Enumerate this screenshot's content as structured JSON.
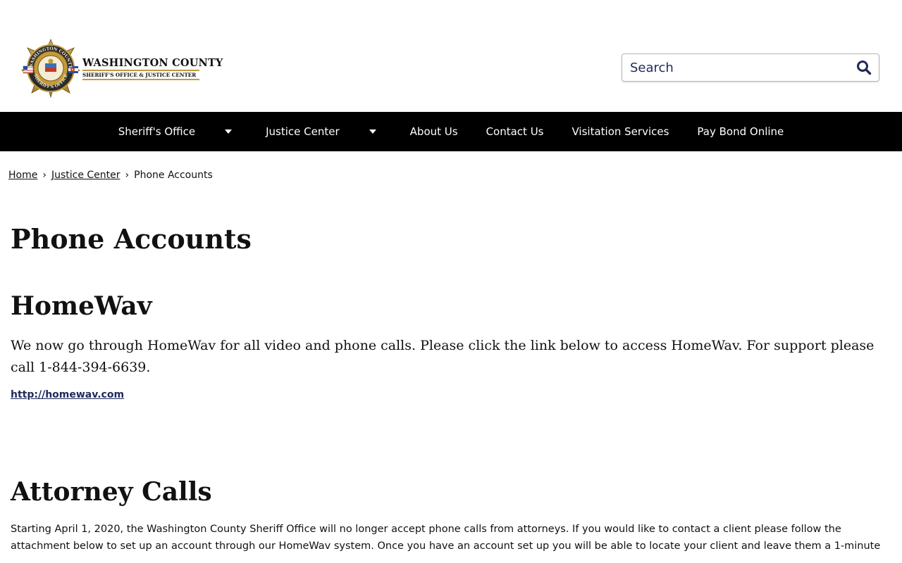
{
  "header": {
    "logo_title": "WASHINGTON COUNTY",
    "logo_subtitle": "SHERIFF'S OFFICE & JUSTICE CENTER",
    "badge_lettering": "WASHINGTON COUNTY SHERIFF'S OFFICE",
    "search_placeholder": "Search",
    "search_value": ""
  },
  "nav": {
    "items": [
      {
        "label": "Sheriff's Office",
        "has_dropdown": true
      },
      {
        "label": "Justice Center",
        "has_dropdown": true
      },
      {
        "label": "About Us",
        "has_dropdown": false
      },
      {
        "label": "Contact Us",
        "has_dropdown": false
      },
      {
        "label": "Visitation Services",
        "has_dropdown": false
      },
      {
        "label": "Pay Bond Online",
        "has_dropdown": false
      }
    ]
  },
  "breadcrumb": {
    "items": [
      "Home",
      "Justice Center",
      "Phone Accounts"
    ],
    "separator": "›"
  },
  "main": {
    "page_title": "Phone Accounts",
    "homewav": {
      "heading": "HomeWav",
      "text": "We now go through HomeWav for all video and phone calls. Please click the link below to access HomeWav. For support please call 1-844-394-6639.",
      "link": "http://homewav.com"
    },
    "attorney": {
      "heading": "Attorney Calls",
      "text": "Starting April 1, 2020, the Washington County Sheriff Office will no longer accept phone calls from attorneys.  If you would like to contact a client please follow the attachment below to set up an account through our HomeWav system.  Once you have an account set up you will be able to locate your client and leave them a 1-minute"
    }
  },
  "colors": {
    "nav_bg": "#000000",
    "link": "#1f2a5a",
    "accent_gold": "#c39a3a"
  }
}
